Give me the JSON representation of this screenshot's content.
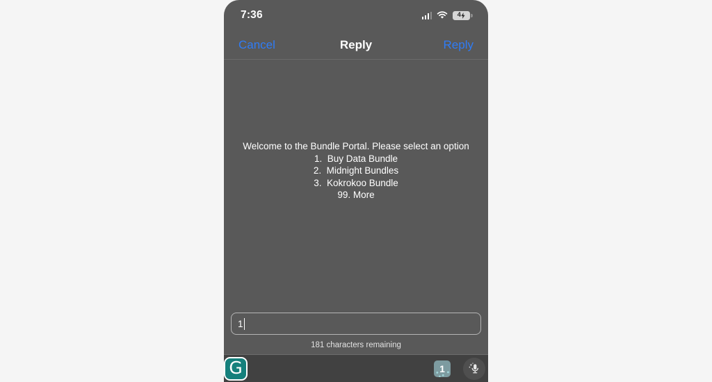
{
  "status_bar": {
    "time": "7:36",
    "cellular_icon": "cellular-signal-icon",
    "wifi_icon": "wifi-icon",
    "battery_icon": "battery-charging-icon",
    "battery_level": "4"
  },
  "nav_bar": {
    "cancel_label": "Cancel",
    "title": "Reply",
    "reply_label": "Reply",
    "link_color": "#2f7cf6"
  },
  "message": {
    "header": "Welcome to the Bundle Portal. Please select an option",
    "options": [
      "1.  Buy Data Bundle",
      "2.  Midnight Bundles",
      "3.  Kokrokoo Bundle",
      "99. More"
    ]
  },
  "compose": {
    "value": "1",
    "placeholder": "",
    "char_counter": "181 characters remaining"
  },
  "keyboard_toolbar": {
    "grammarly_icon": "grammarly-logo-icon",
    "grammarly_letter": "G",
    "grammarly_color": "#15807c",
    "suggestion_chip": "1",
    "mic_icon": "microphone-dictation-icon"
  },
  "theme": {
    "page_background": "#f5f5f5",
    "screen_background": "#595959",
    "toolbar_background": "#414141",
    "text_color": "#ffffff"
  }
}
